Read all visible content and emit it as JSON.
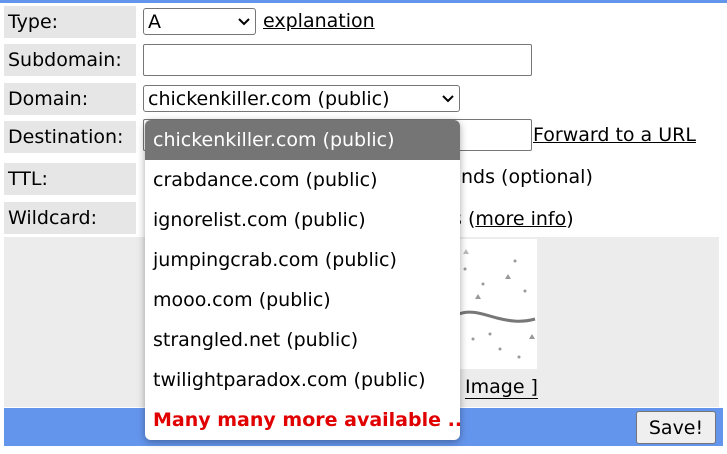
{
  "form": {
    "type_label": "Type:",
    "type_value": "A",
    "explanation_link": "explanation",
    "subdomain_label": "Subdomain:",
    "subdomain_value": "",
    "domain_label": "Domain:",
    "domain_value": "chickenkiller.com (public)",
    "destination_label": "Destination:",
    "destination_value": "",
    "forward_link": "Forward to a URL",
    "ttl_label": "TTL:",
    "ttl_suffix": "nds (optional)",
    "wildcard_label": "Wildcard:",
    "wildcard_suffix_before": "s (",
    "more_info_link": "more info",
    "wildcard_suffix_after": ")",
    "image_link": "Image ]",
    "save_label": "Save!"
  },
  "dropdown": {
    "options": [
      "chickenkiller.com (public)",
      "crabdance.com (public)",
      "ignorelist.com (public)",
      "jumpingcrab.com (public)",
      "mooo.com (public)",
      "strangled.net (public)",
      "twilightparadox.com (public)",
      "Many many more available ..."
    ],
    "selected_index": 0
  },
  "icons": {
    "select_arrow": "chevron-down-icon"
  },
  "colors": {
    "accent": "#6495ed",
    "label_bg": "#e6e6e6",
    "more_text": "#e00000",
    "selected_bg": "#757575"
  }
}
